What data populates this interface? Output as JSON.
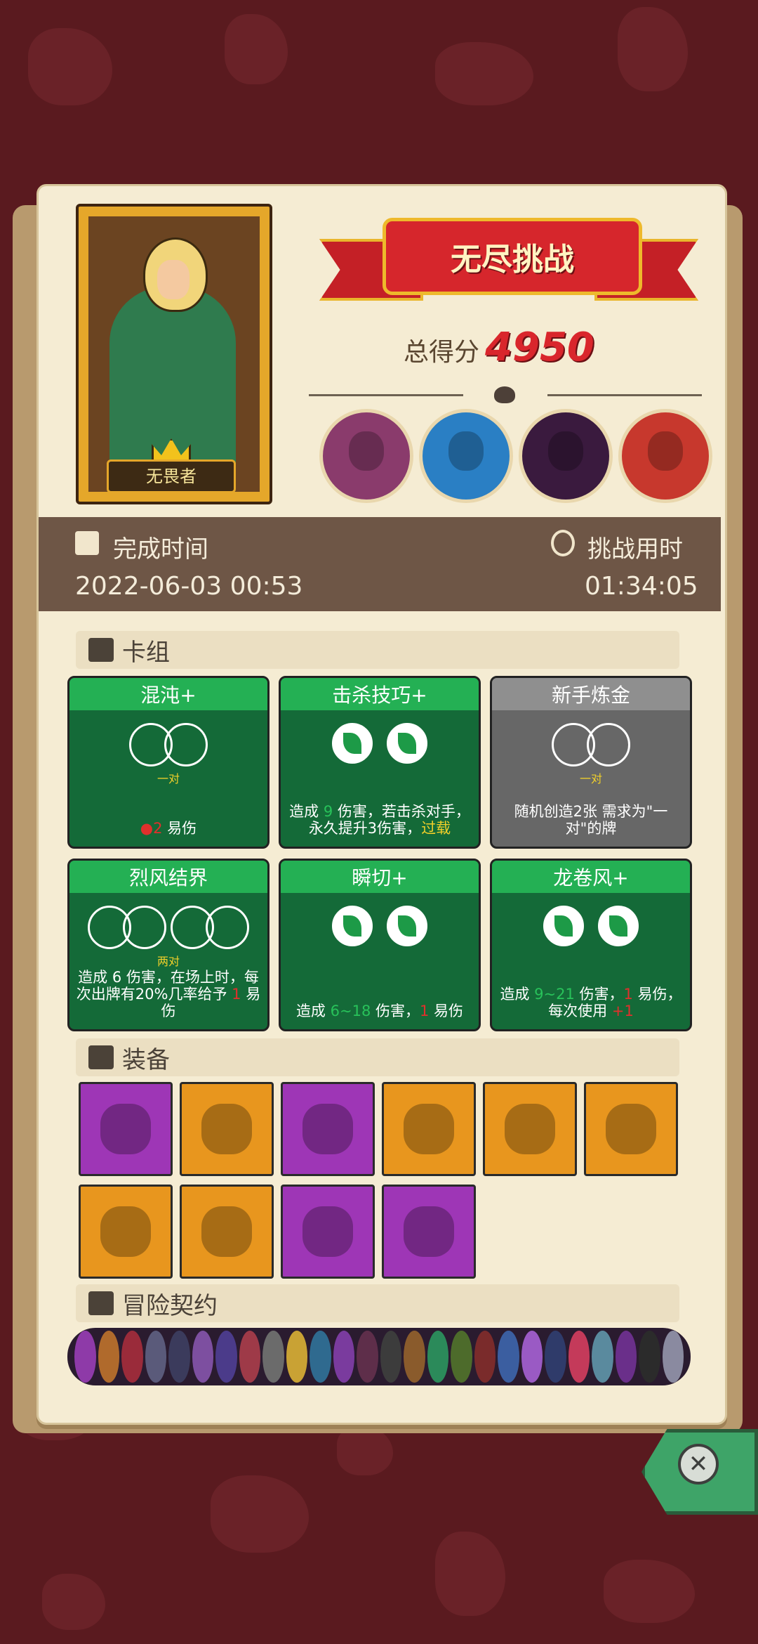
{
  "hero": {
    "title": "无畏者"
  },
  "banner": {
    "title": "无尽挑战"
  },
  "score": {
    "label": "总得分",
    "value": "4950"
  },
  "bosses": [
    {
      "name": "boss-1-icon",
      "color": "#8a3b6c"
    },
    {
      "name": "boss-2-icon",
      "color": "#2a7fc4"
    },
    {
      "name": "boss-3-icon",
      "color": "#3a1a3e"
    },
    {
      "name": "boss-4-icon",
      "color": "#c7382d"
    }
  ],
  "info": {
    "finish_label": "完成时间",
    "finish_value": "2022-06-03  00:53",
    "duration_label": "挑战用时",
    "duration_value": "01:34:05"
  },
  "sections": {
    "deck": "卡组",
    "equipment": "装备",
    "contract": "冒险契约"
  },
  "cards": [
    {
      "name": "混沌+",
      "style": "green",
      "sub": "一对",
      "desc_prefix": "",
      "desc_parts": [
        "2",
        " 易伤"
      ]
    },
    {
      "name": "击杀技巧+",
      "style": "green",
      "sub": "",
      "desc_parts": [
        "造成 ",
        "9",
        " 伤害，若击杀对手，永久提升3伤害，",
        "过载"
      ]
    },
    {
      "name": "新手炼金",
      "style": "gray",
      "sub": "一对",
      "desc_parts": [
        "随机创造2张 需求为\"一对\"的牌"
      ]
    },
    {
      "name": "烈风结界",
      "style": "green",
      "sub": "两对",
      "desc_parts": [
        "造成 ",
        "6",
        " 伤害，在场上时，每次出牌有20%几率给予 ",
        "1",
        " 易伤"
      ]
    },
    {
      "name": "瞬切+",
      "style": "green",
      "sub": "",
      "desc_parts": [
        "造成 ",
        "6~18",
        " 伤害，",
        "1",
        " 易伤"
      ]
    },
    {
      "name": "龙卷风+",
      "style": "green",
      "sub": "",
      "desc_parts": [
        "造成 ",
        "9~21",
        " 伤害，",
        "1",
        " 易伤，每次使用 ",
        "+1"
      ]
    }
  ],
  "equipment": [
    {
      "name": "equip-slash-icon",
      "bg": "purple"
    },
    {
      "name": "equip-demon-mask-icon",
      "bg": "orange"
    },
    {
      "name": "equip-red-gem-necklace-icon",
      "bg": "purple"
    },
    {
      "name": "equip-dark-beast-icon",
      "bg": "orange"
    },
    {
      "name": "equip-blue-slime-icon",
      "bg": "orange"
    },
    {
      "name": "equip-blue-shield-icon",
      "bg": "orange"
    },
    {
      "name": "equip-meat-icon",
      "bg": "orange"
    },
    {
      "name": "equip-dark-ring-icon",
      "bg": "orange"
    },
    {
      "name": "equip-golden-chest-icon",
      "bg": "purple"
    },
    {
      "name": "equip-mushroom-icon",
      "bg": "purple"
    }
  ],
  "contract_colors": [
    "#8e3aa8",
    "#b06a2c",
    "#9a2b3a",
    "#5a5a7a",
    "#3b3b5c",
    "#7d4fa0",
    "#4b3b8a",
    "#9e3a48",
    "#6b6b6b",
    "#c9a234",
    "#2f6a8f",
    "#7a3b9e",
    "#5e2e4a",
    "#3c3c3c",
    "#8a5b2c",
    "#2b8a5a",
    "#4d6b2b",
    "#7a2b2b",
    "#3b5ea0",
    "#9a5ac4",
    "#2f3b6a",
    "#c43a5a",
    "#5a8a9e",
    "#6a2f8a",
    "#2b2b2b",
    "#8a8aa0"
  ],
  "close": {
    "icon": "close-icon"
  }
}
